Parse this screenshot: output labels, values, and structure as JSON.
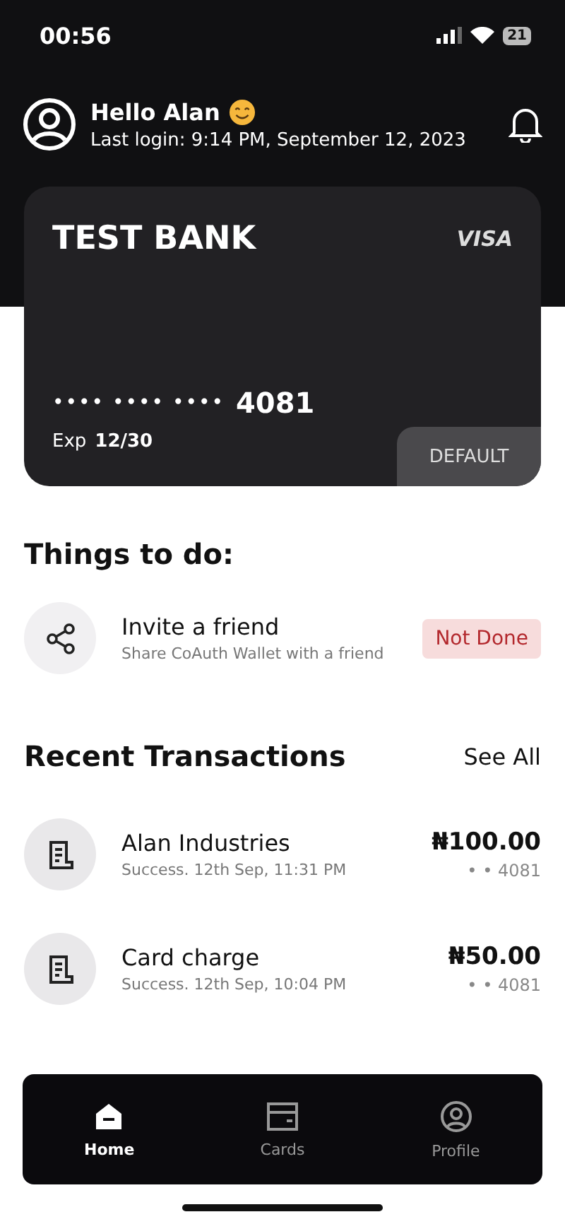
{
  "status_bar": {
    "time": "00:56",
    "battery": "21"
  },
  "header": {
    "greeting": "Hello Alan",
    "last_login": "Last login: 9:14 PM, September 12, 2023"
  },
  "card": {
    "bank": "TEST BANK",
    "network": "VISA",
    "masked_number": "•••• •••• ••••",
    "last4": "4081",
    "exp_label": "Exp",
    "exp": "12/30",
    "badge": "DEFAULT"
  },
  "todo": {
    "title": "Things to do:",
    "items": [
      {
        "title": "Invite a friend",
        "subtitle": "Share CoAuth Wallet with a friend",
        "status": "Not Done",
        "done": false
      }
    ]
  },
  "transactions": {
    "title": "Recent Transactions",
    "see_all": "See All",
    "rows": [
      {
        "name": "Alan Industries",
        "detail": "Success. 12th Sep, 11:31 PM",
        "amount": "₦100.00",
        "card": "• • 4081"
      },
      {
        "name": "Card charge",
        "detail": "Success. 12th Sep, 10:04 PM",
        "amount": "₦50.00",
        "card": "• • 4081"
      }
    ]
  },
  "tabs": [
    {
      "label": "Home",
      "selected": true,
      "kind": "home"
    },
    {
      "label": "Cards",
      "selected": false,
      "kind": "cards"
    },
    {
      "label": "Profile",
      "selected": false,
      "kind": "profile"
    }
  ]
}
